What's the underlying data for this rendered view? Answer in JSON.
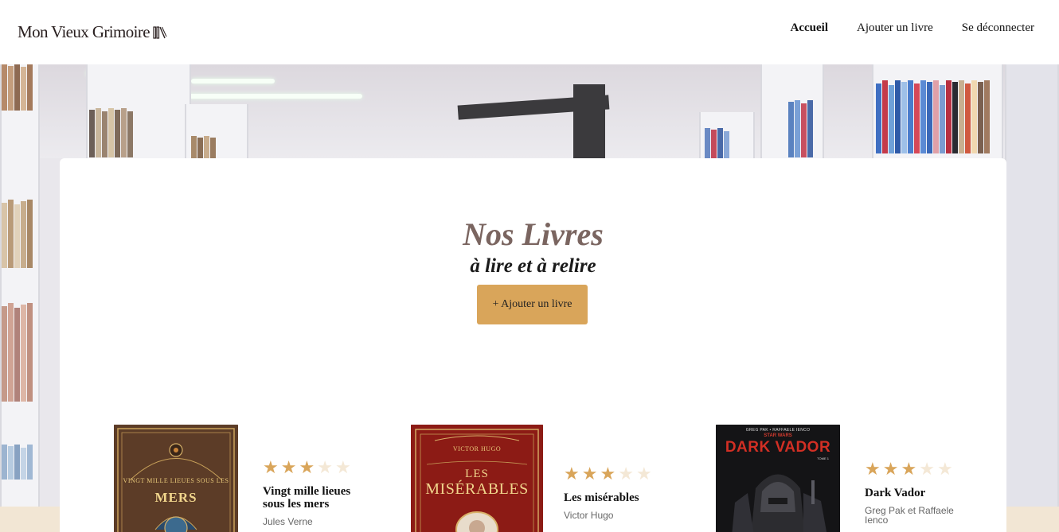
{
  "header": {
    "logo_text": "Mon Vieux Grimoire",
    "nav": [
      {
        "label": "Accueil",
        "active": true
      },
      {
        "label": "Ajouter un livre",
        "active": false
      },
      {
        "label": "Se déconnecter",
        "active": false
      }
    ]
  },
  "main": {
    "title": "Nos Livres",
    "subtitle": "à lire et à relire",
    "add_button": "+ Ajouter un livre"
  },
  "books": [
    {
      "title": "Vingt mille lieues sous les mers",
      "author": "Jules Verne",
      "rating": 3,
      "max_rating": 5,
      "cover_text": [
        "VINGT MILLE LIEUES SOUS LES",
        "MERS"
      ]
    },
    {
      "title": "Les misérables",
      "author": "Victor Hugo",
      "rating": 3,
      "max_rating": 5,
      "cover_text": [
        "VICTOR HUGO",
        "LES",
        "MISÉRABLES"
      ]
    },
    {
      "title": "Dark Vador",
      "author": "Greg Pak et Raffaele Ienco",
      "rating": 3,
      "max_rating": 5,
      "cover_text": [
        "GREG PAK • RAFFAELE IENCO",
        "STAR WARS",
        "DARK VADOR",
        "TOME 1"
      ]
    }
  ],
  "colors": {
    "accent": "#d9a55a",
    "title": "#7a6560",
    "star_empty": "#f4e8d6"
  }
}
